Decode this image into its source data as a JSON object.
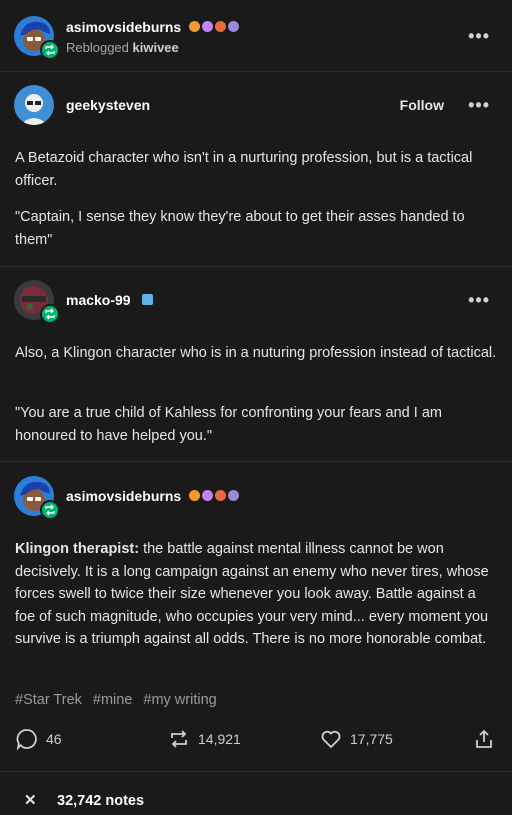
{
  "header": {
    "username": "asimovsideburns",
    "reblogged_prefix": "Reblogged",
    "reblogged_from": "kiwivee",
    "more_label": "•••"
  },
  "post1": {
    "username": "geekysteven",
    "follow_label": "Follow",
    "more_label": "•••",
    "para1": "A Betazoid character who isn't in a nurturing profession, but is a tactical officer.",
    "para2": "\"Captain, I sense they know they're about to get their asses handed to them\""
  },
  "post2": {
    "username": "macko-99",
    "more_label": "•••",
    "para1": "Also, a Klingon character who is in a nuturing profession instead of tactical.",
    "para2": "\"You are a true child of Kahless for confronting your fears and I am honoured to have helped you.\""
  },
  "post3": {
    "username": "asimovsideburns",
    "bold_lead": "Klingon therapist:",
    "body": " the battle against mental illness cannot be won decisively. It is a long campaign against an enemy who never tires, whose forces swell to twice their size whenever you look away. Battle against a foe of such magnitude, who occupies your very mind... every moment you survive is a triumph against all odds. There is no more honorable combat."
  },
  "tags": [
    "#Star Trek",
    "#mine",
    "#my writing"
  ],
  "actions": {
    "comments": "46",
    "reblogs": "14,921",
    "likes": "17,775"
  },
  "notes": {
    "close_label": "✕",
    "count_label": "32,742 notes"
  },
  "colors": {
    "background": "#1a1a1a",
    "reblog_green": "#00b56e"
  },
  "icons": [
    "reblog-icon",
    "comment-icon",
    "heart-icon",
    "share-icon",
    "close-icon",
    "more-icon"
  ]
}
